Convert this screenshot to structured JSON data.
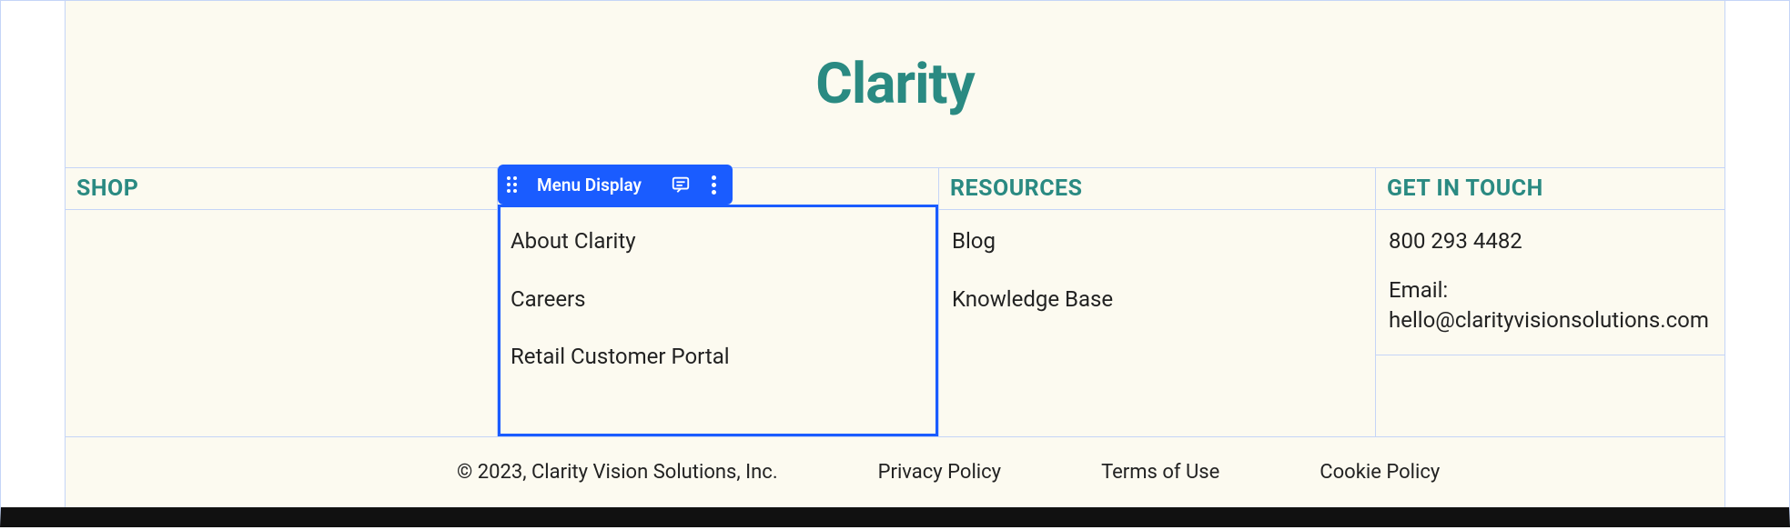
{
  "logo": "Clarity",
  "editor": {
    "selected_widget_label": "Menu Display"
  },
  "columns": {
    "shop": {
      "title": "SHOP"
    },
    "company": {
      "items": [
        "About Clarity",
        "Careers",
        "Retail Customer Portal"
      ]
    },
    "resources": {
      "title": "RESOURCES",
      "items": [
        "Blog",
        "Knowledge Base"
      ]
    },
    "contact": {
      "title": "GET IN TOUCH",
      "phone": "800 293 4482",
      "email_line": "Email: hello@clarityvisionsolutions.com"
    }
  },
  "footer": {
    "copyright": "© 2023, Clarity Vision Solutions, Inc.",
    "links": [
      "Privacy Policy",
      "Terms of Use",
      "Cookie Policy"
    ]
  }
}
